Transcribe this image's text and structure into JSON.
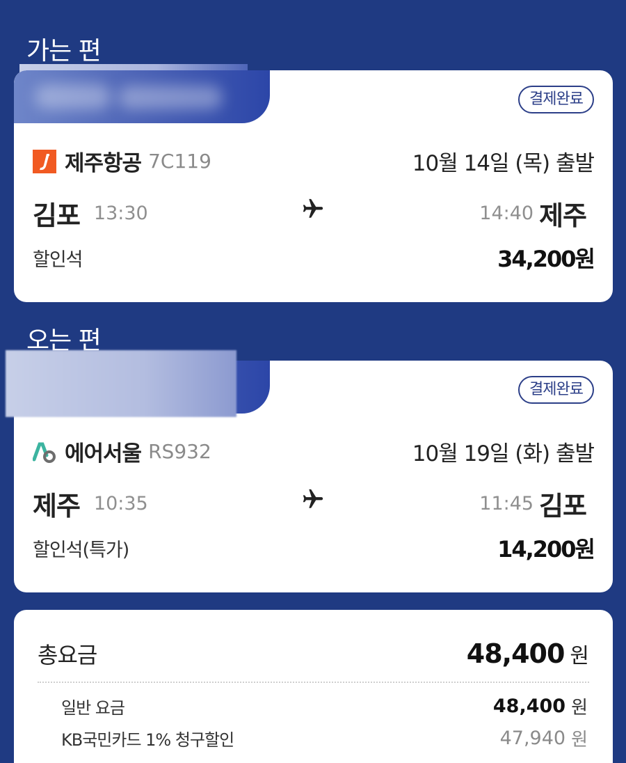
{
  "outbound": {
    "section_title": "가는 편",
    "status_badge": "결제완료",
    "airline": "제주항공",
    "flight_no": "7C119",
    "depart_date": "10월 14일 (목) 출발",
    "from_city": "김포",
    "from_time": "13:30",
    "to_time": "14:40",
    "to_city": "제주",
    "seat_class": "할인석",
    "price": "34,200원",
    "logo_icon": "jeju-air-logo-icon",
    "logo_color": "#f15a22"
  },
  "inbound": {
    "section_title": "오는 편",
    "status_badge": "결제완료",
    "airline": "에어서울",
    "flight_no": "RS932",
    "depart_date": "10월 19일 (화) 출발",
    "from_city": "제주",
    "from_time": "10:35",
    "to_time": "11:45",
    "to_city": "김포",
    "seat_class": "할인석(특가)",
    "price": "14,200원",
    "logo_icon": "air-seoul-logo-icon",
    "logo_color": "#3cb4a0"
  },
  "summary": {
    "total_label": "총요금",
    "total_value": "48,400",
    "total_unit": "원",
    "lines": [
      {
        "label": "일반 요금",
        "value": "48,400",
        "unit": "원"
      },
      {
        "label": "KB국민카드 1% 청구할인",
        "value": "47,940",
        "unit": "원"
      }
    ]
  },
  "colors": {
    "background": "#1f3a82",
    "badge": "#2c3f88"
  }
}
